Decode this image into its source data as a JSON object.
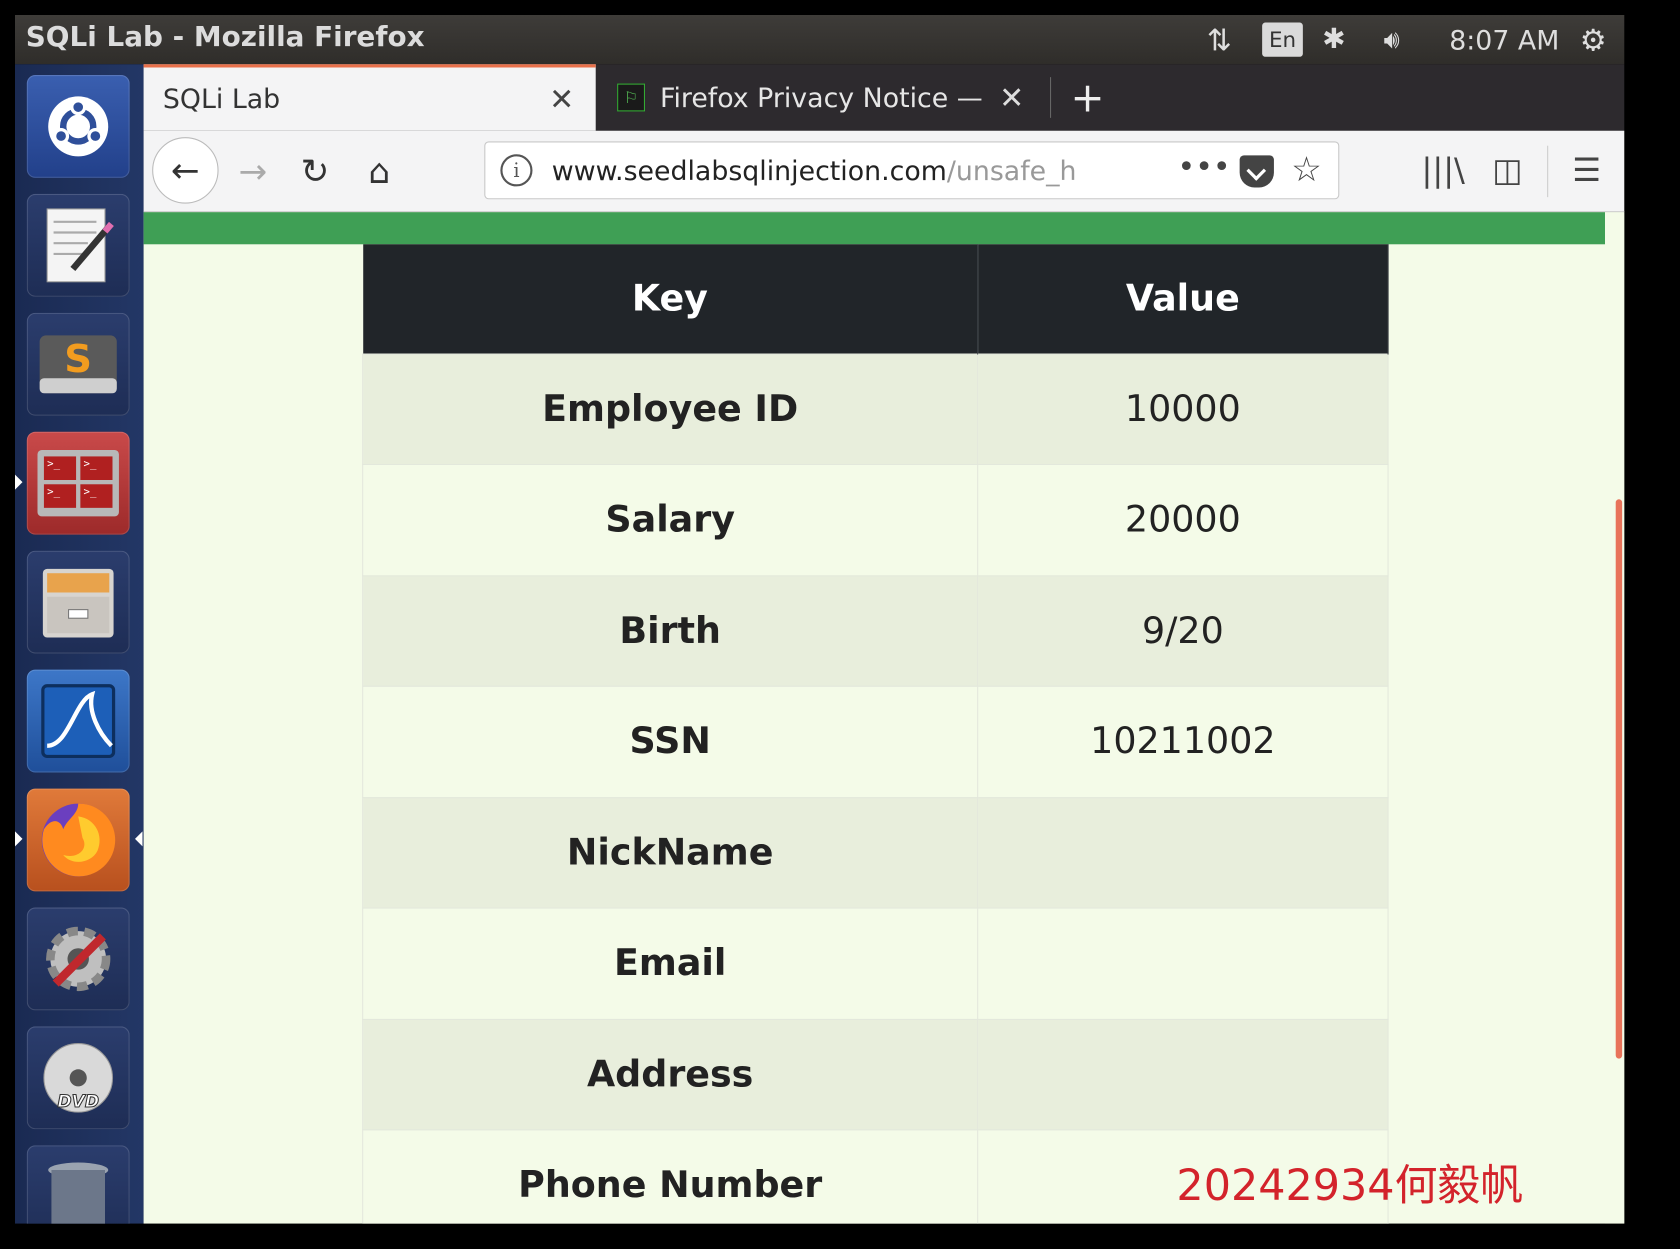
{
  "window": {
    "title": "SQLi Lab - Mozilla Firefox"
  },
  "panel": {
    "language": "En",
    "clock": "8:07 AM",
    "icons": [
      "network-updown-icon",
      "bluetooth-icon",
      "volume-icon",
      "power-gear-icon"
    ]
  },
  "launcher": {
    "items": [
      "ubuntu-dash-icon",
      "text-editor-icon",
      "sublime-text-icon",
      "terminal-icon",
      "files-icon",
      "wireshark-icon",
      "firefox-icon",
      "system-settings-icon",
      "dvd-icon",
      "trash-icon"
    ]
  },
  "tabs": [
    {
      "title": "SQLi Lab",
      "active": true
    },
    {
      "title": "Firefox Privacy Notice — ",
      "favicon": "⚐",
      "active": false
    }
  ],
  "urlbar": {
    "url_host": "www.seedlabsqlinjection.com",
    "url_path": "/unsafe_h"
  },
  "table": {
    "headers": {
      "key": "Key",
      "value": "Value"
    },
    "rows": [
      {
        "key": "Employee ID",
        "value": "10000"
      },
      {
        "key": "Salary",
        "value": "20000"
      },
      {
        "key": "Birth",
        "value": "9/20"
      },
      {
        "key": "SSN",
        "value": "10211002"
      },
      {
        "key": "NickName",
        "value": ""
      },
      {
        "key": "Email",
        "value": ""
      },
      {
        "key": "Address",
        "value": ""
      },
      {
        "key": "Phone Number",
        "value": ""
      }
    ]
  },
  "watermark": "20242934何毅帆",
  "colors": {
    "accent_green": "#3f9f55",
    "tab_accent": "#e8704a",
    "watermark": "#d3232b"
  }
}
